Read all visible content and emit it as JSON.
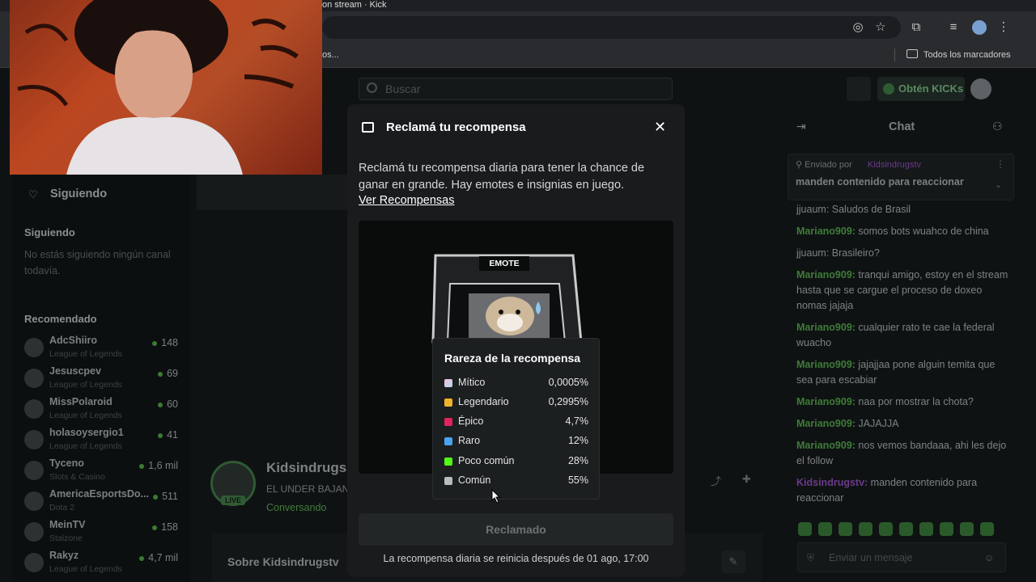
{
  "browser": {
    "tab_title": "on stream · Kick",
    "bookmarks_left": "os...",
    "bookmarks_all": "Todos los marcadores",
    "icons": [
      "eye-off-icon",
      "star-icon",
      "extensions-icon",
      "media-icon",
      "profile-icon",
      "menu-icon"
    ]
  },
  "site": {
    "search_placeholder": "Buscar",
    "get_kicks": "Obtén KICKs",
    "sidebar": {
      "following_nav": "Siguiendo",
      "following_title": "Siguiendo",
      "following_empty": "No estás siguiendo ningún canal todavía.",
      "recommended_title": "Recomendado",
      "recommended": [
        {
          "name": "AdcShiiro",
          "game": "League of Legends",
          "viewers": "148"
        },
        {
          "name": "Jesuscpev",
          "game": "League of Legends",
          "viewers": "69"
        },
        {
          "name": "MissPolaroid",
          "game": "League of Legends",
          "viewers": "60"
        },
        {
          "name": "holasoysergio1",
          "game": "League of Legends",
          "viewers": "41"
        },
        {
          "name": "Tyceno",
          "game": "Slots & Casino",
          "viewers": "1,6 mil"
        },
        {
          "name": "AmericaEsportsDo...",
          "game": "Dota 2",
          "viewers": "511"
        },
        {
          "name": "MeinTV",
          "game": "Stalzone",
          "viewers": "158"
        },
        {
          "name": "Rakyz",
          "game": "League of Legends",
          "viewers": "4,7 mil"
        }
      ]
    },
    "channel": {
      "name": "Kidsindrugs",
      "title": "EL UNDER BAJAN",
      "category": "Conversando",
      "live": "LIVE",
      "about": "Sobre Kidsindrugstv"
    },
    "chat": {
      "title": "Chat",
      "pinned_by_label": "Enviado por",
      "pinned_by_user": "Kidsindrugstv",
      "pinned_message": "manden contenido para reaccionar",
      "input_placeholder": "Enviar un mensaje",
      "messages": [
        {
          "user": "jjuaum:",
          "text": " Saludos de Brasil",
          "gray": true
        },
        {
          "user": "Mariano909:",
          "text": " somos bots wuahco de china"
        },
        {
          "user": "jjuaum:",
          "text": " Brasileiro?",
          "gray": true
        },
        {
          "user": "Mariano909:",
          "text": " tranqui amigo, estoy en el stream hasta que se cargue el proceso de doxeo nomas jajaja"
        },
        {
          "user": "Mariano909:",
          "text": " cualquier rato te cae la federal wuacho"
        },
        {
          "user": "Mariano909:",
          "text": " jajajjaa pone alguin temita que sea para escabiar"
        },
        {
          "user": "Mariano909:",
          "text": " naa por mostrar la chota?"
        },
        {
          "user": "Mariano909:",
          "text": " JAJAJJA"
        },
        {
          "user": "Mariano909:",
          "text": " nos vemos bandaaa, ahi les dejo el follow"
        },
        {
          "user": "Kidsindrugstv:",
          "text": " manden contenido para reaccionar",
          "purple": true
        }
      ]
    }
  },
  "modal": {
    "title": "Reclamá tu recompensa",
    "description": "Reclamá tu recompensa diaria para tener la chance de ganar en grande. Hay emotes e insignias en juego.",
    "link": "Ver Recompensas",
    "card_label": "EMOTE",
    "claim_button": "Reclamado",
    "reset_note": "La recompensa diaria se reinicia después de 01 ago, 17:00",
    "rarity": {
      "title": "Rareza de la recompensa",
      "items": [
        {
          "name": "Mítico",
          "pct": "0,0005%",
          "color": "#d9d0e8"
        },
        {
          "name": "Legendario",
          "pct": "0,2995%",
          "color": "#f0b429"
        },
        {
          "name": "Épico",
          "pct": "4,7%",
          "color": "#e0245e"
        },
        {
          "name": "Raro",
          "pct": "12%",
          "color": "#4aa3f0"
        },
        {
          "name": "Poco común",
          "pct": "28%",
          "color": "#53fc18"
        },
        {
          "name": "Común",
          "pct": "55%",
          "color": "#b8bcbf"
        }
      ]
    }
  }
}
